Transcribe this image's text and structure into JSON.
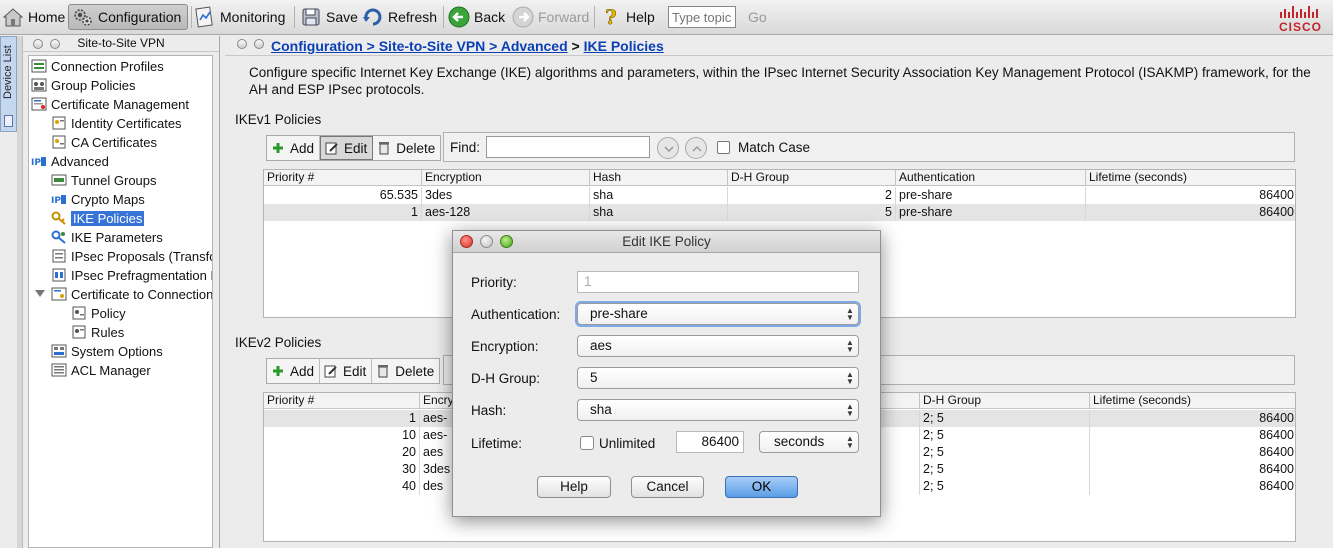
{
  "toolbar": {
    "home": "Home",
    "configuration": "Configuration",
    "monitoring": "Monitoring",
    "save": "Save",
    "refresh": "Refresh",
    "back": "Back",
    "forward": "Forward",
    "help": "Help",
    "search_placeholder": "Type topic",
    "go": "Go",
    "brand": "CISCO"
  },
  "device_list_tab": "Device List",
  "nav": {
    "title": "Site-to-Site VPN",
    "items": [
      {
        "label": "Connection Profiles",
        "icon": "connection-profiles-icon"
      },
      {
        "label": "Group Policies",
        "icon": "group-policies-icon"
      },
      {
        "label": "Certificate Management",
        "icon": "certificate-management-icon"
      },
      {
        "label": "Identity Certificates",
        "icon": "identity-certificates-icon"
      },
      {
        "label": "CA Certificates",
        "icon": "ca-certificates-icon"
      },
      {
        "label": "Advanced",
        "icon": "advanced-icon"
      },
      {
        "label": "Tunnel Groups",
        "icon": "tunnel-groups-icon"
      },
      {
        "label": "Crypto Maps",
        "icon": "crypto-maps-icon"
      },
      {
        "label": "IKE Policies",
        "icon": "ike-policies-icon"
      },
      {
        "label": "IKE Parameters",
        "icon": "ike-parameters-icon"
      },
      {
        "label": "IPsec Proposals (Transfo",
        "icon": "ipsec-proposals-icon"
      },
      {
        "label": "IPsec Prefragmentation P",
        "icon": "ipsec-prefragmentation-icon"
      },
      {
        "label": "Certificate to Connection",
        "icon": "certificate-to-connection-icon"
      },
      {
        "label": "Policy",
        "icon": "policy-icon"
      },
      {
        "label": "Rules",
        "icon": "rules-icon"
      },
      {
        "label": "System Options",
        "icon": "system-options-icon"
      },
      {
        "label": "ACL Manager",
        "icon": "acl-manager-icon"
      }
    ]
  },
  "breadcrumb": {
    "link": "Configuration > Site-to-Site VPN > Advanced",
    "sep": ">",
    "current": "IKE Policies"
  },
  "description": "Configure specific Internet Key Exchange (IKE) algorithms and parameters, within the IPsec Internet Security Association Key Management Protocol (ISAKMP) framework, for the AH and ESP IPsec protocols.",
  "ikev1": {
    "title": "IKEv1 Policies",
    "add": "Add",
    "edit": "Edit",
    "delete": "Delete",
    "find_label": "Find:",
    "match_case": "Match Case",
    "columns": [
      "Priority #",
      "Encryption",
      "Hash",
      "D-H Group",
      "Authentication",
      "Lifetime (seconds)"
    ],
    "rows": [
      [
        "65.535",
        "3des",
        "sha",
        "2",
        "pre-share",
        "86400"
      ],
      [
        "1",
        "aes-128",
        "sha",
        "5",
        "pre-share",
        "86400"
      ]
    ]
  },
  "ikev2": {
    "title": "IKEv2 Policies",
    "add": "Add",
    "edit": "Edit",
    "delete": "Delete",
    "columns": [
      "Priority #",
      "Encry",
      "D-H Group",
      "Lifetime (seconds)"
    ],
    "rows": [
      [
        "1",
        "aes-",
        "2; 5",
        "86400"
      ],
      [
        "10",
        "aes-",
        "2; 5",
        "86400"
      ],
      [
        "20",
        "aes",
        "2; 5",
        "86400"
      ],
      [
        "30",
        "3des",
        "2; 5",
        "86400"
      ],
      [
        "40",
        "des",
        "2; 5",
        "86400"
      ]
    ]
  },
  "dialog": {
    "title": "Edit IKE Policy",
    "priority_label": "Priority:",
    "priority_value": "1",
    "authentication_label": "Authentication:",
    "authentication_value": "pre-share",
    "encryption_label": "Encryption:",
    "encryption_value": "aes",
    "dh_label": "D-H Group:",
    "dh_value": "5",
    "hash_label": "Hash:",
    "hash_value": "sha",
    "lifetime_label": "Lifetime:",
    "unlimited_label": "Unlimited",
    "lifetime_value": "86400",
    "lifetime_unit": "seconds",
    "help": "Help",
    "cancel": "Cancel",
    "ok": "OK"
  },
  "colors": {
    "link": "#0b3fb5",
    "selection": "#3874d8",
    "cisco_red": "#c2252c"
  }
}
